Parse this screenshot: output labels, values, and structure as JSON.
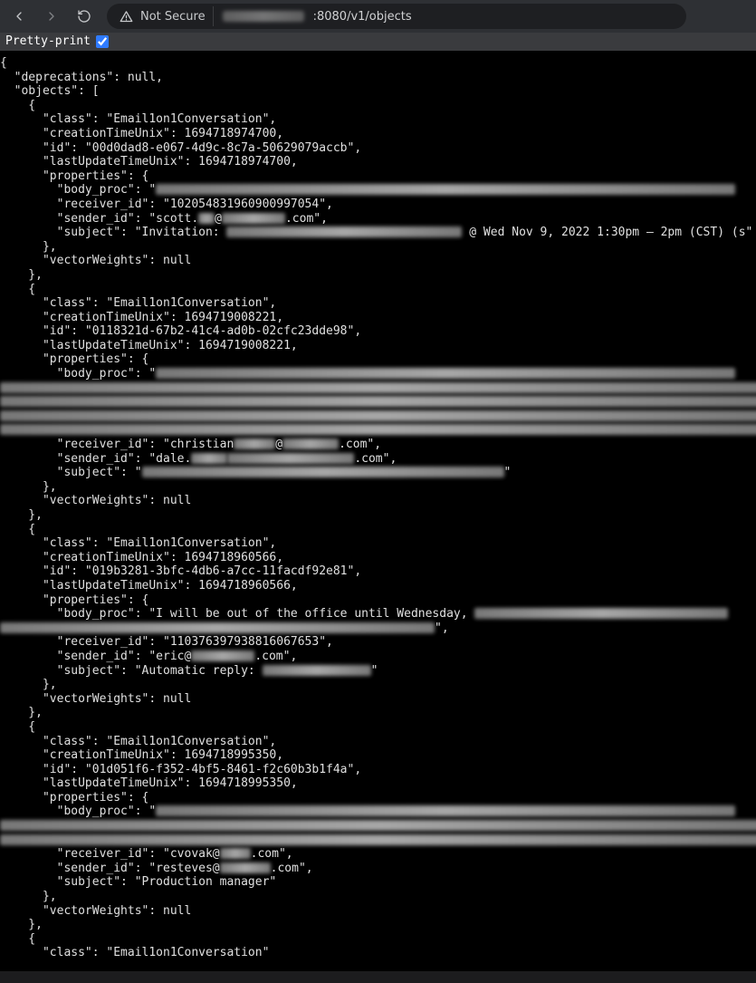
{
  "toolbar": {
    "not_secure": "Not Secure",
    "url_suffix": ":8080/v1/objects"
  },
  "ppbar": {
    "label": "Pretty-print"
  },
  "json": {
    "deprecations_key": "deprecations",
    "objects_key": "objects",
    "class_key": "class",
    "creationTimeUnix_key": "creationTimeUnix",
    "id_key": "id",
    "lastUpdateTimeUnix_key": "lastUpdateTimeUnix",
    "properties_key": "properties",
    "body_proc_key": "body_proc",
    "receiver_id_key": "receiver_id",
    "sender_id_key": "sender_id",
    "subject_key": "subject",
    "vectorWeights_key": "vectorWeights",
    "deprecations_val": "null",
    "vectorWeights_val": "null"
  },
  "objects": [
    {
      "class": "Email1on1Conversation",
      "creationTimeUnix": 1694718974700,
      "id": "00d0dad8-e067-4d9c-8c7a-50629079accb",
      "lastUpdateTimeUnix": 1694718974700,
      "body_proc_prefix": "",
      "body_proc_redacted_widths": [
        640
      ],
      "receiver_id": "102054831960900997054",
      "sender_parts": {
        "prefix": "scott.",
        "redact1_w": 18,
        "mid": "@",
        "redact2_w": 70,
        "suffix": ".com"
      },
      "subject_prefix": "Invitation: ",
      "subject_redact_w": 260,
      "subject_suffix": " @ Wed Nov 9, 2022 1:30pm – 2pm (CST) (s"
    },
    {
      "class": "Email1on1Conversation",
      "creationTimeUnix": 1694719008221,
      "id": "0118321d-67b2-41c4-ad0b-02cfc23dde98",
      "lastUpdateTimeUnix": 1694719008221,
      "body_proc_prefix": "",
      "body_proc_redacted_widths": [
        640,
        840,
        840,
        840,
        840
      ],
      "receiver_parts": {
        "prefix": "christian",
        "redact1_w": 46,
        "mid": "@",
        "redact2_w": 62,
        "suffix": ".com"
      },
      "sender_parts": {
        "prefix": "dale.",
        "redact1_w": 40,
        "mid": "",
        "redact2_w": 140,
        "suffix": ".com"
      },
      "subject_prefix": "",
      "subject_redact_w": 400,
      "subject_suffix": ""
    },
    {
      "class": "Email1on1Conversation",
      "creationTimeUnix": 1694718960566,
      "id": "019b3281-3bfc-4db6-a7cc-11facdf92e81",
      "lastUpdateTimeUnix": 1694718960566,
      "body_proc_prefix": "I will be out of the office until Wednesday, ",
      "body_proc_redacted_widths": [
        280,
        480
      ],
      "receiver_id": "110376397938816067653",
      "sender_parts": {
        "prefix": "eric@",
        "redact1_w": 0,
        "mid": "",
        "redact2_w": 70,
        "suffix": ".com"
      },
      "subject_prefix": "Automatic reply: ",
      "subject_redact_w": 120,
      "subject_suffix": ""
    },
    {
      "class": "Email1on1Conversation",
      "creationTimeUnix": 1694718995350,
      "id": "01d051f6-f352-4bf5-8461-f2c60b3b1f4a",
      "lastUpdateTimeUnix": 1694718995350,
      "body_proc_prefix": "",
      "body_proc_redacted_widths": [
        640,
        840,
        840
      ],
      "receiver_parts": {
        "prefix": "cvovak@",
        "redact1_w": 0,
        "mid": "",
        "redact2_w": 34,
        "suffix": ".com"
      },
      "sender_parts": {
        "prefix": "resteves@",
        "redact1_w": 0,
        "mid": "",
        "redact2_w": 56,
        "suffix": ".com"
      },
      "subject_plain": "Production manager"
    },
    {
      "class": "Email1on1Conversation"
    }
  ]
}
